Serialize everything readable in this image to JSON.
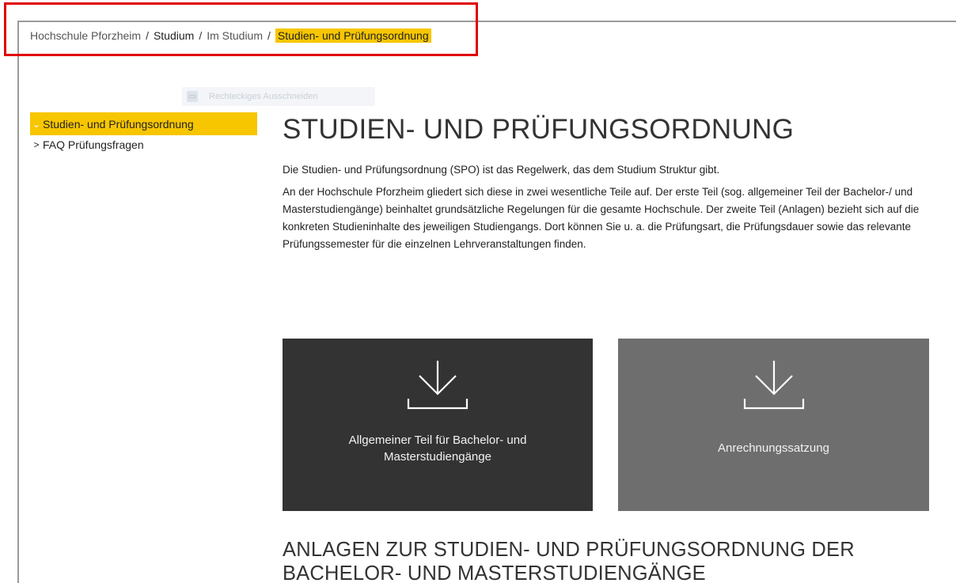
{
  "breadcrumb": {
    "items": [
      "Hochschule Pforzheim",
      "Studium",
      "Im Studium"
    ],
    "separator": "/",
    "current": "Studien- und Prüfungsordnung"
  },
  "ghost_toolbar": {
    "label": "Rechteckiges Ausschneiden"
  },
  "sidebar": {
    "items": [
      {
        "label": "Studien- und Prüfungsordnung",
        "chevron": "⌄",
        "active": true
      },
      {
        "label": "FAQ Prüfungsfragen",
        "chevron": ">",
        "active": false
      }
    ]
  },
  "main": {
    "title": "STUDIEN- UND PRÜFUNGSORDNUNG",
    "intro": "Die Studien- und Prüfungsordnung (SPO) ist das Regelwerk, das dem Studium Struktur gibt.",
    "body": "An der Hochschule Pforzheim gliedert sich diese in zwei wesentliche Teile auf. Der erste Teil (sog. allgemeiner Teil der Bachelor-/ und Masterstudiengänge) beinhaltet grundsätzliche Regelungen für die gesamte Hochschule. Der zweite Teil (Anlagen) bezieht sich auf die konkreten Studieninhalte des jeweiligen Studiengangs. Dort können Sie u. a. die Prüfungsart, die Prüfungsdauer sowie das relevante Prüfungssemester für die einzelnen Lehrveranstaltungen finden."
  },
  "downloads": [
    {
      "label_line1": "Allgemeiner Teil für Bachelor- und",
      "label_line2": "Masterstudiengänge",
      "icon": "download-icon",
      "color": "#333333"
    },
    {
      "label_line1": "Anrechnungssatzung",
      "label_line2": "",
      "icon": "download-icon",
      "color": "#6e6e6e"
    }
  ],
  "section": {
    "title": "ANLAGEN ZUR STUDIEN- UND PRÜFUNGSORDNUNG DER BACHELOR- UND MASTERSTUDIENGÄNGE"
  },
  "colors": {
    "accent": "#f7c600",
    "annotation": "#e00000"
  }
}
